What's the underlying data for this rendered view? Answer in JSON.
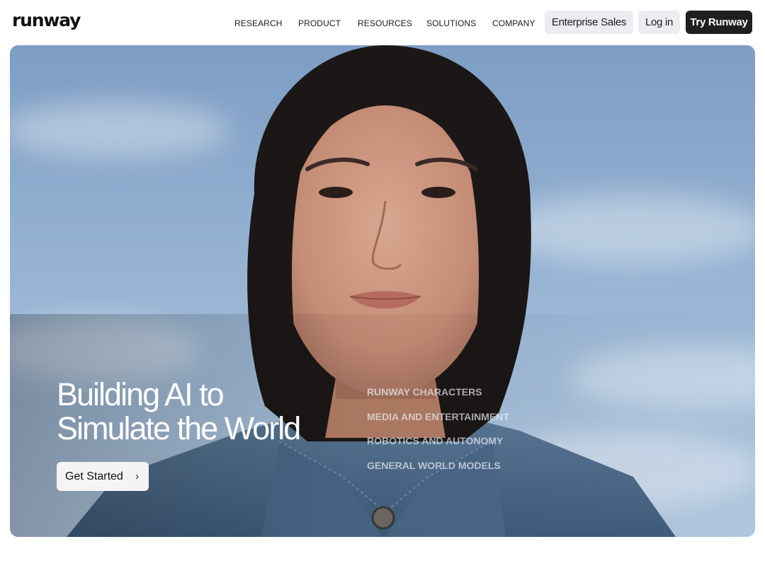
{
  "header": {
    "logo": "runway",
    "nav": [
      "RESEARCH",
      "PRODUCT",
      "RESOURCES",
      "SOLUTIONS",
      "COMPANY"
    ],
    "enterprise_label": "Enterprise Sales",
    "login_label": "Log in",
    "try_label": "Try Runway"
  },
  "hero": {
    "title_line1": "Building AI to",
    "title_line2": "Simulate the World",
    "cta_label": "Get Started",
    "cta_icon": "chevron-right-icon",
    "categories": [
      "RUNWAY CHARACTERS",
      "MEDIA AND ENTERTAINMENT",
      "ROBOTICS AND AUTONOMY",
      "GENERAL WORLD MODELS"
    ]
  },
  "colors": {
    "primary_button": "#1f1f1f",
    "secondary_button": "#ebedf0",
    "hero_sky": "#92afd0"
  }
}
